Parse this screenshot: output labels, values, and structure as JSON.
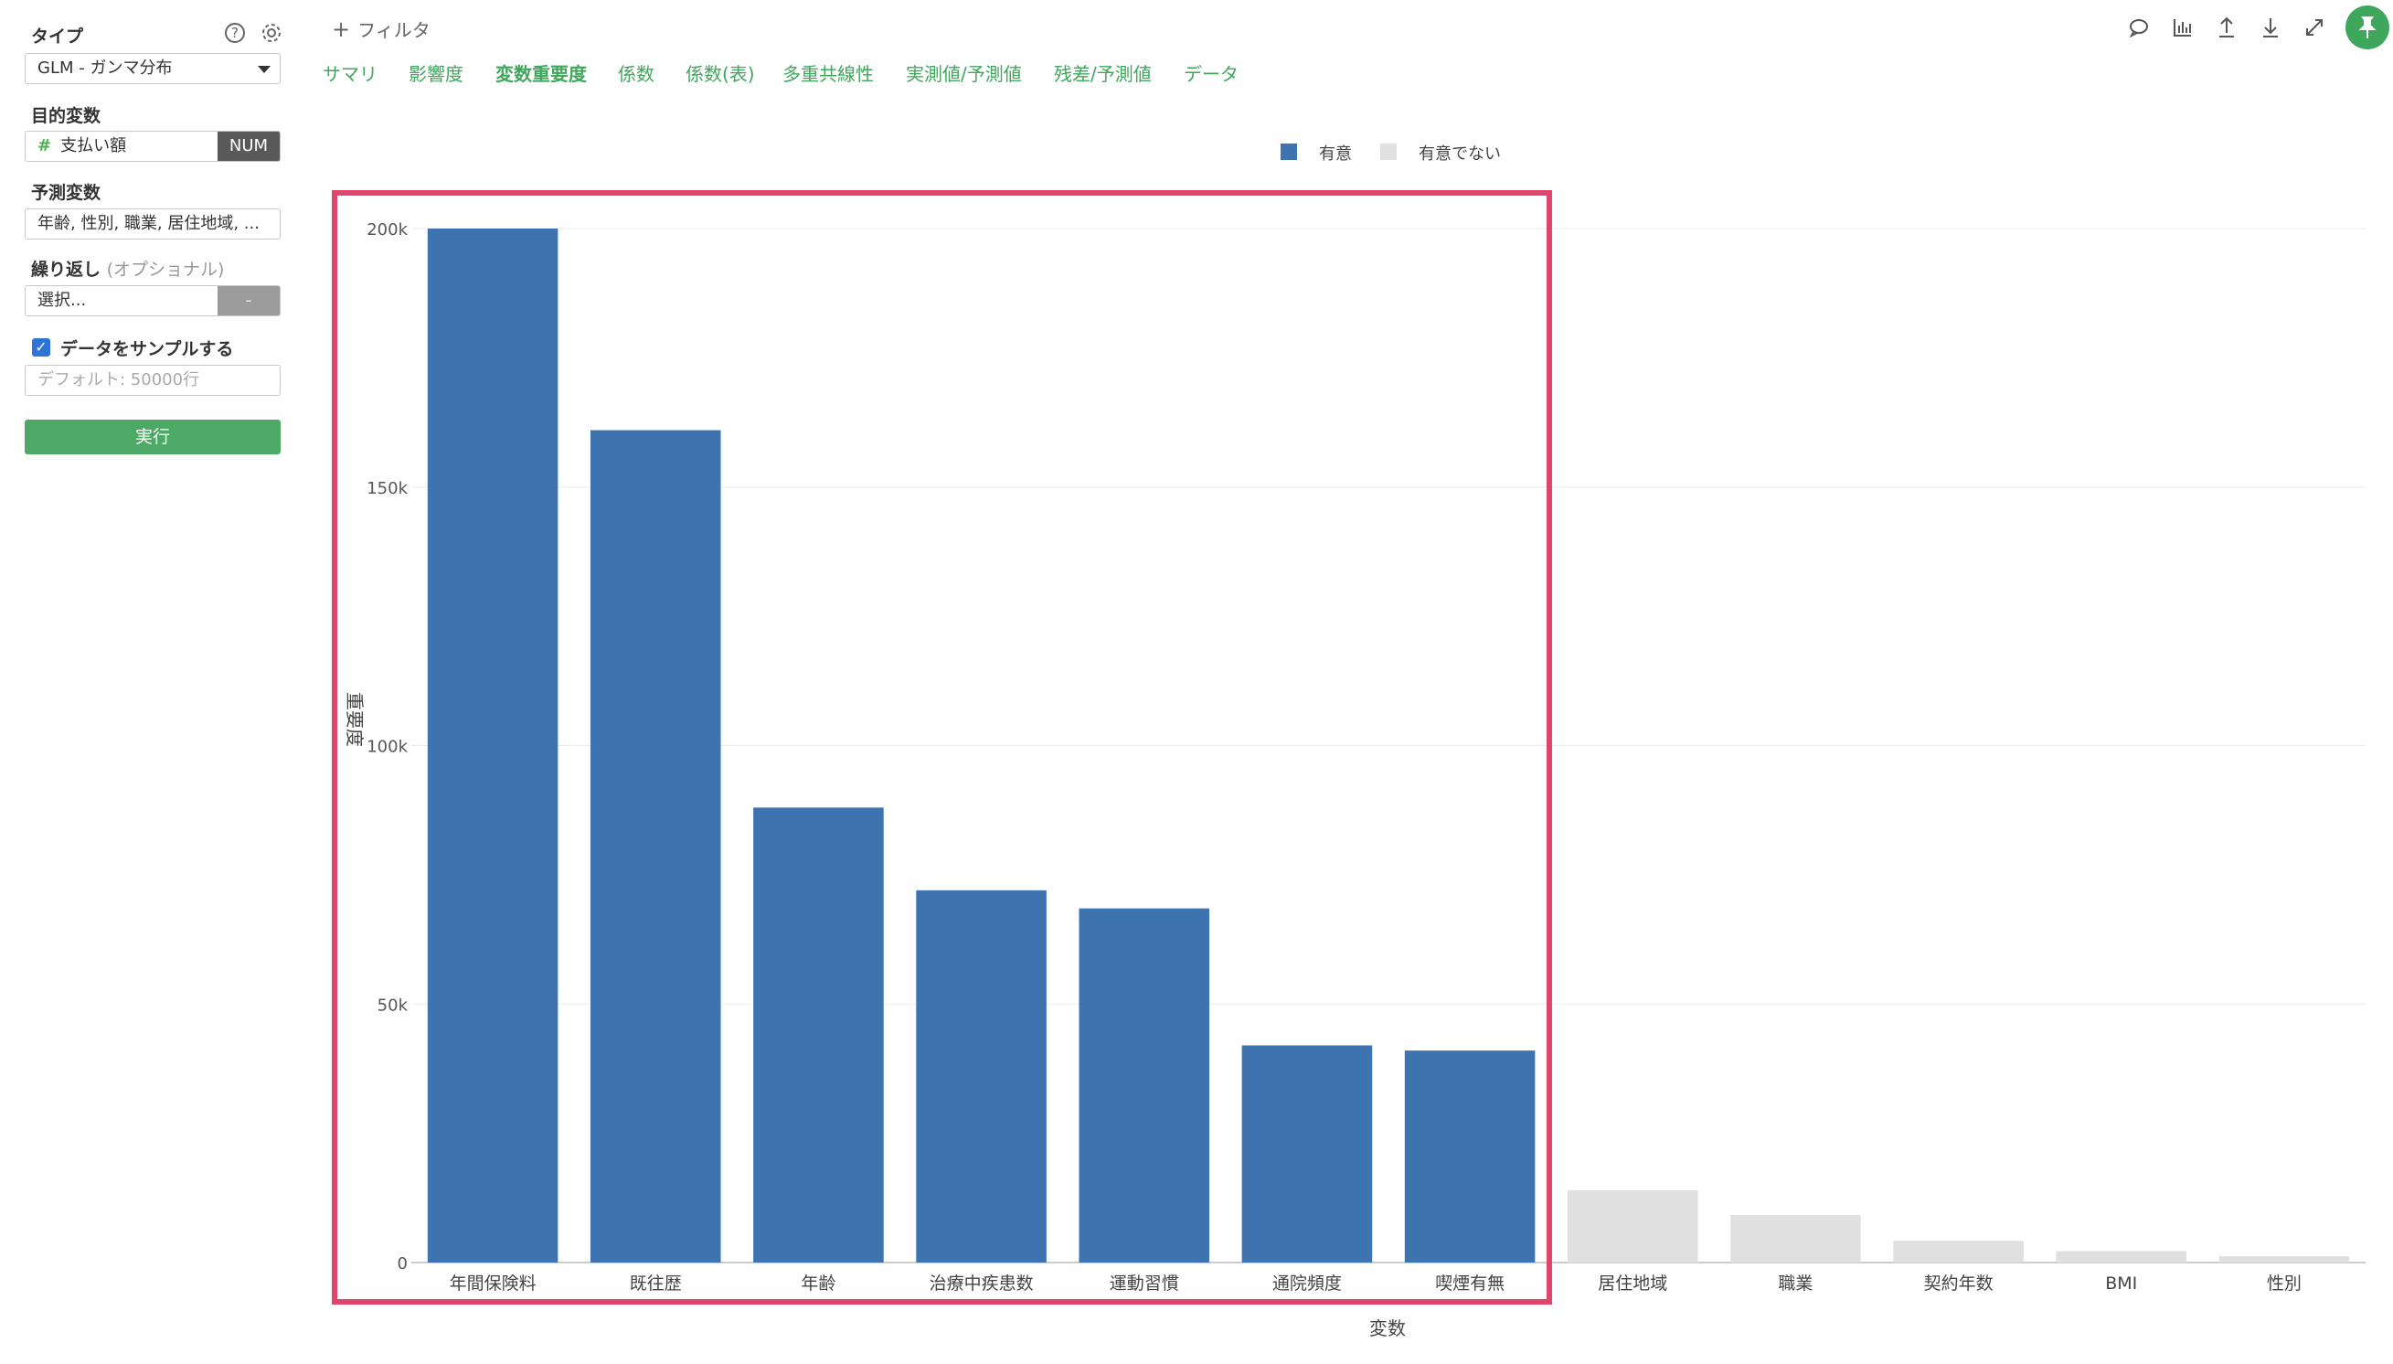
{
  "sidebar": {
    "type_label": "タイプ",
    "type_value": "GLM - ガンマ分布",
    "target_label": "目的変数",
    "target_value": "支払い額",
    "target_tag": "NUM",
    "predictor_label": "予測変数",
    "predictor_value": "年齢, 性別, 職業, 居住地域, ...",
    "repeat_label": "繰り返し",
    "repeat_optional": "(オプショナル)",
    "repeat_placeholder": "選択...",
    "repeat_tag": "-",
    "sample_label": "データをサンプルする",
    "sample_placeholder": "デフォルト: 50000行",
    "run_label": "実行",
    "help_icon": "?"
  },
  "toolbar": {
    "filter_label": "フィルタ",
    "tabs": [
      "サマリ",
      "影響度",
      "変数重要度",
      "係数",
      "係数(表)",
      "多重共線性",
      "実測値/予測値",
      "残差/予測値",
      "データ"
    ],
    "active_tab": "変数重要度"
  },
  "legend": {
    "significant": "有意",
    "not_significant": "有意でない"
  },
  "colors": {
    "significant": "#3d74b0",
    "not_significant": "#e0e0e0",
    "highlight": "#e0456b",
    "accent": "#3fa75c"
  },
  "chart_data": {
    "type": "bar",
    "xlabel": "変数",
    "ylabel": "重要度",
    "ylim": [
      0,
      200000
    ],
    "yticks": [
      0,
      50000,
      100000,
      150000,
      200000
    ],
    "ytick_labels": [
      "0",
      "50k",
      "100k",
      "150k",
      "200k"
    ],
    "categories": [
      "年間保険料",
      "既往歴",
      "年齢",
      "治療中疾患数",
      "運動習慣",
      "通院頻度",
      "喫煙有無",
      "居住地域",
      "職業",
      "契約年数",
      "BMI",
      "性別"
    ],
    "values": [
      200000,
      161000,
      88000,
      72000,
      68500,
      42000,
      41000,
      14000,
      9200,
      4200,
      2200,
      1200
    ],
    "significant": [
      true,
      true,
      true,
      true,
      true,
      true,
      true,
      false,
      false,
      false,
      false,
      false
    ],
    "grid": true,
    "legend_position": "top-center"
  }
}
